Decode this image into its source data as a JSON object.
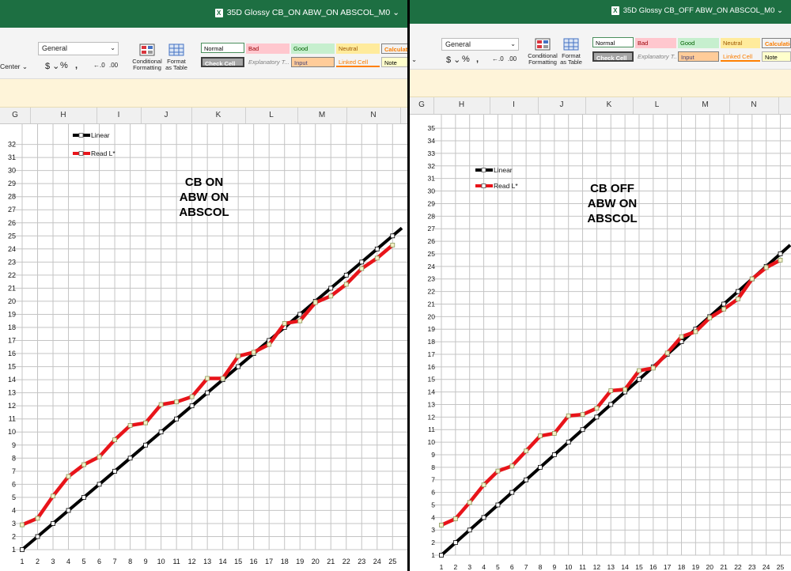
{
  "windows": [
    {
      "title": "35D Glossy CB_ON ABW_ON ABSCOL_M0",
      "ribbon": {
        "number_format": "General",
        "alignment_cut": "Center",
        "conditional_formatting": [
          "Conditional",
          "Formatting"
        ],
        "format_as_table": [
          "Format",
          "as Table"
        ],
        "styles": [
          "Normal",
          "Bad",
          "Good",
          "Neutral",
          "Calculation",
          "Check Cell",
          "Explanatory T...",
          "Input",
          "Linked Cell",
          "Note"
        ]
      },
      "columns": [
        "G",
        "H",
        "I",
        "J",
        "K",
        "L",
        "M",
        "N"
      ]
    },
    {
      "title": "35D Glossy CB_OFF ABW_ON ABSCOL_M0",
      "ribbon": {
        "number_format": "General",
        "alignment_cut": "",
        "conditional_formatting": [
          "Conditional",
          "Formatting"
        ],
        "format_as_table": [
          "Format",
          "as Table"
        ],
        "styles": [
          "Normal",
          "Bad",
          "Good",
          "Neutral",
          "Calculation",
          "Check Cell",
          "Explanatory T...",
          "Input",
          "Linked Cell",
          "Note"
        ]
      },
      "columns": [
        "G",
        "H",
        "I",
        "J",
        "K",
        "L",
        "M",
        "N"
      ]
    }
  ],
  "chart_data": [
    {
      "type": "line",
      "title": "CB ON\nABW ON\nABSCOL",
      "x": [
        1,
        2,
        3,
        4,
        5,
        6,
        7,
        8,
        9,
        10,
        11,
        12,
        13,
        14,
        15,
        16,
        17,
        18,
        19,
        20,
        21,
        22,
        23,
        24,
        25
      ],
      "xlim": [
        1,
        25.6
      ],
      "ylim": [
        1,
        32.7
      ],
      "yticks": [
        1,
        2,
        3,
        4,
        5,
        6,
        7,
        8,
        9,
        10,
        11,
        12,
        13,
        14,
        15,
        16,
        17,
        18,
        19,
        20,
        21,
        22,
        23,
        24,
        25,
        26,
        27,
        28,
        29,
        30,
        31,
        32
      ],
      "grid": true,
      "legend": "top-left",
      "series": [
        {
          "name": "Linear",
          "color": "#000000",
          "values": [
            1,
            2,
            3,
            4,
            5,
            6,
            7,
            8,
            9,
            10,
            11,
            12,
            13,
            14,
            15,
            16,
            17,
            18,
            19,
            20,
            21,
            22,
            23,
            24,
            25
          ]
        },
        {
          "name": "Read L*",
          "color": "#e8141a",
          "values": [
            2.9,
            3.4,
            5.1,
            6.6,
            7.5,
            8.1,
            9.4,
            10.5,
            10.7,
            12.1,
            12.3,
            12.7,
            14.1,
            14.1,
            15.8,
            16.1,
            16.7,
            18.3,
            18.5,
            19.9,
            20.4,
            21.3,
            22.5,
            23.3,
            24.3
          ]
        }
      ]
    },
    {
      "type": "line",
      "title": "CB OFF\nABW ON\nABSCOL",
      "x": [
        1,
        2,
        3,
        4,
        5,
        6,
        7,
        8,
        9,
        10,
        11,
        12,
        13,
        14,
        15,
        16,
        17,
        18,
        19,
        20,
        21,
        22,
        23,
        24,
        25
      ],
      "xlim": [
        1,
        25.7
      ],
      "ylim": [
        1,
        35.2
      ],
      "yticks": [
        1,
        2,
        3,
        4,
        5,
        6,
        7,
        8,
        9,
        10,
        11,
        12,
        13,
        14,
        15,
        16,
        17,
        18,
        19,
        20,
        21,
        22,
        23,
        24,
        25,
        26,
        27,
        28,
        29,
        30,
        31,
        32,
        33,
        34,
        35
      ],
      "grid": true,
      "legend": "top-left",
      "series": [
        {
          "name": "Linear",
          "color": "#000000",
          "values": [
            1,
            2,
            3,
            4,
            5,
            6,
            7,
            8,
            9,
            10,
            11,
            12,
            13,
            14,
            15,
            16,
            17,
            18,
            19,
            20,
            21,
            22,
            23,
            24,
            25
          ]
        },
        {
          "name": "Read L*",
          "color": "#e8141a",
          "values": [
            3.4,
            3.9,
            5.2,
            6.6,
            7.7,
            8.1,
            9.3,
            10.5,
            10.7,
            12.1,
            12.2,
            12.7,
            14.1,
            14.2,
            15.7,
            15.9,
            17.1,
            18.4,
            18.8,
            19.9,
            20.6,
            21.4,
            23,
            23.9,
            24.5
          ]
        }
      ]
    }
  ]
}
